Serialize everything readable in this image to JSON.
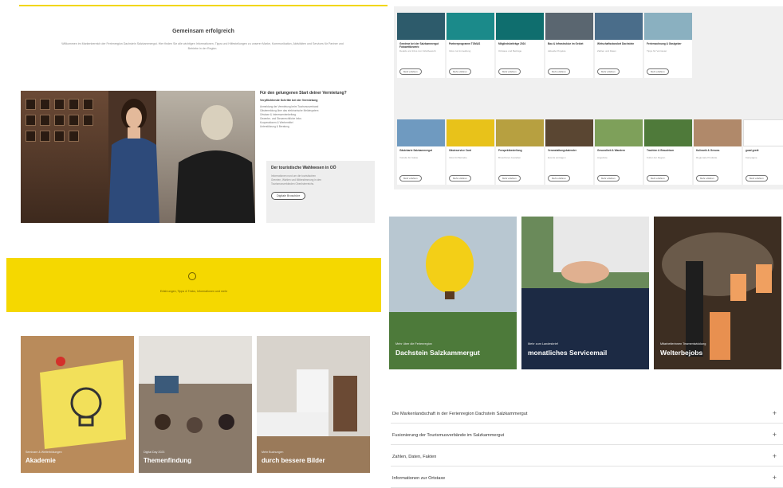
{
  "left": {
    "intro_title": "Gemeinsam erfolgreich",
    "intro_text": "Willkommen im Markenbereich der Ferienregion Dachstein Salzkammergut. Hier finden Sie alle wichtigen Informationen, Tipps und Hilfestellungen zu unserer Marke, Kommunikation, Aktivitäten und Services für Partner und Betriebe in der Region.",
    "side_title": "Für den gelungenen Start deiner Vermietung?",
    "side_sub": "Verpflichtende Schritte bei der Vermietung",
    "side_lines": [
      "Anmeldung der Vermietung beim Tourismusverband",
      "Gästemeldung über das elektronische Meldesystem",
      "Ortstaxe & Interessentenbeitrag",
      "Gewerbe- und Steuerrechtliche Infos",
      "Kooperationen & Werbemittel",
      "Unterstützung & Beratung"
    ],
    "card_title": "Der touristische Wahlwesen in OÖ",
    "card_lines": [
      "Informationen rund um die touristischen",
      "Gremien, Wahlen und Mitbestimmung in den",
      "Tourismusverbänden Oberösterreichs."
    ],
    "card_button": "Digitale Broschüre",
    "yellow_text": "Erfahrungen, Tipps & Tricks, Informationen und mehr",
    "tiles": [
      {
        "sub": "Seminare & Weiterbildungen",
        "title": "Akademie"
      },
      {
        "sub": "Digital Day 2023",
        "title": "Themenfindung"
      },
      {
        "sub": "Mehr Buchungen",
        "title": "durch bessere Bilder"
      }
    ]
  },
  "right": {
    "cards_row1": [
      {
        "title": "Gewinne bei der Salzkammergut Fotowettbewerb",
        "text": "Details und Infos zum Wettbewerb",
        "button": "Mehr erfahren",
        "color": "#2d5b6b"
      },
      {
        "title": "Partnerprogramm TOMAS",
        "text": "Infos zur Anmeldung",
        "button": "Mehr erfahren",
        "color": "#1b8a8a"
      },
      {
        "title": "Mitgliedsbeiträge 2024",
        "text": "Ortstaxe und Beiträge",
        "button": "Mehr erfahren",
        "color": "#0f6e6e"
      },
      {
        "title": "Bau & Infrastruktur im Gebiet",
        "text": "Aktuelle Projekte",
        "button": "Mehr erfahren",
        "color": "#5a6670"
      },
      {
        "title": "Wirtschaftsstandort Dachstein",
        "text": "Zahlen und Daten",
        "button": "Mehr erfahren",
        "color": "#4a6d8a"
      },
      {
        "title": "Ferienwohnung & Gastgeber",
        "text": "Tipps für Vermieter",
        "button": "Mehr erfahren",
        "color": "#8ab0c0"
      }
    ],
    "cards_row2": [
      {
        "title": "Gästekarte Salzkammergut",
        "text": "Vorteile für Gäste",
        "button": "Mehr erfahren",
        "color": "#6f9ac0"
      },
      {
        "title": "Gästeservice Card",
        "text": "Infos für Betriebe",
        "button": "Mehr erfahren",
        "color": "#e8c21a"
      },
      {
        "title": "Prospektbestellung",
        "text": "Broschüren bestellen",
        "button": "Mehr erfahren",
        "color": "#b7a040"
      },
      {
        "title": "Veranstaltungskalender",
        "text": "Events eintragen",
        "button": "Mehr erfahren",
        "color": "#5a4632"
      },
      {
        "title": "Gesundheit & Wandern",
        "text": "Angebote",
        "button": "Mehr erfahren",
        "color": "#7ea05a"
      },
      {
        "title": "Trachten & Brauchtum",
        "text": "Kultur der Region",
        "button": "Mehr erfahren",
        "color": "#4f7a3a"
      },
      {
        "title": "Kulinarik & Genuss",
        "text": "Regionale Produkte",
        "button": "Mehr erfahren",
        "color": "#b0896a"
      },
      {
        "title": "guad gredt",
        "text": "Kampagne",
        "button": "Mehr erfahren",
        "color": "#ffffff"
      }
    ],
    "features": [
      {
        "sub": "Mehr über die Ferienregion",
        "title": "Dachstein Salzkammergut"
      },
      {
        "sub": "Mehr zum Landesbrief",
        "title": "monatliches Servicemail"
      },
      {
        "sub": "Mitarbeiterinnen Teamentwicklung",
        "title": "Welterbejobs"
      }
    ],
    "accordion": [
      "Die Markenlandschaft in der Ferienregion Dachstein Salzkammergut",
      "Fusionierung der Tourismusverbände im Salzkammergut",
      "Zahlen, Daten, Fakten",
      "Informationen zur Ortstaxe"
    ],
    "plus_glyph": "+"
  },
  "colors": {
    "accent_yellow": "#f5d800",
    "text": "#333333"
  }
}
